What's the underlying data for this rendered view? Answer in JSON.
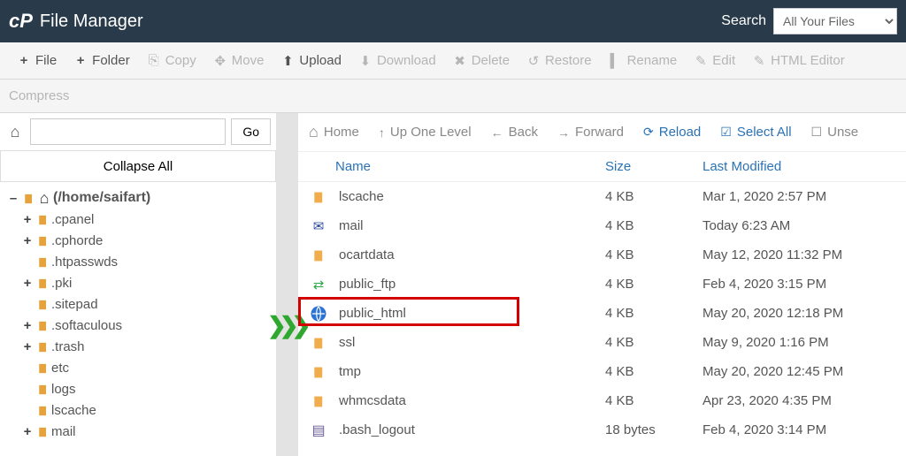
{
  "brand": {
    "logo": "cP",
    "title": "File Manager"
  },
  "search": {
    "label": "Search",
    "selected": "All Your Files"
  },
  "toolbar": {
    "file": "File",
    "folder": "Folder",
    "copy": "Copy",
    "move": "Move",
    "upload": "Upload",
    "download": "Download",
    "delete": "Delete",
    "restore": "Restore",
    "rename": "Rename",
    "edit": "Edit",
    "html_editor": "HTML Editor",
    "compress": "Compress"
  },
  "left": {
    "go": "Go",
    "collapse": "Collapse All",
    "root": "(/home/saifart)",
    "items": [
      {
        "label": ".cpanel",
        "expander": "plus",
        "icon": "folder"
      },
      {
        "label": ".cphorde",
        "expander": "plus",
        "icon": "folder"
      },
      {
        "label": ".htpasswds",
        "expander": "none",
        "icon": "folder"
      },
      {
        "label": ".pki",
        "expander": "plus",
        "icon": "folder"
      },
      {
        "label": ".sitepad",
        "expander": "none",
        "icon": "folder"
      },
      {
        "label": ".softaculous",
        "expander": "plus",
        "icon": "folder"
      },
      {
        "label": ".trash",
        "expander": "plus",
        "icon": "folder"
      },
      {
        "label": "etc",
        "expander": "none",
        "icon": "folder"
      },
      {
        "label": "logs",
        "expander": "none",
        "icon": "folder"
      },
      {
        "label": "lscache",
        "expander": "none",
        "icon": "folder"
      },
      {
        "label": "mail",
        "expander": "plus",
        "icon": "folder"
      }
    ]
  },
  "rnav": {
    "home": "Home",
    "up": "Up One Level",
    "back": "Back",
    "forward": "Forward",
    "reload": "Reload",
    "select_all": "Select All",
    "unselect": "Unse"
  },
  "columns": {
    "name": "Name",
    "size": "Size",
    "modified": "Last Modified"
  },
  "rows": [
    {
      "name": "lscache",
      "icon": "folder",
      "size": "4 KB",
      "modified": "Mar 1, 2020 2:57 PM"
    },
    {
      "name": "mail",
      "icon": "mail",
      "size": "4 KB",
      "modified": "Today 6:23 AM"
    },
    {
      "name": "ocartdata",
      "icon": "folder",
      "size": "4 KB",
      "modified": "May 12, 2020 11:32 PM"
    },
    {
      "name": "public_ftp",
      "icon": "ftp",
      "size": "4 KB",
      "modified": "Feb 4, 2020 3:15 PM"
    },
    {
      "name": "public_html",
      "icon": "globe",
      "size": "4 KB",
      "modified": "May 20, 2020 12:18 PM",
      "highlight": true
    },
    {
      "name": "ssl",
      "icon": "folder",
      "size": "4 KB",
      "modified": "May 9, 2020 1:16 PM"
    },
    {
      "name": "tmp",
      "icon": "folder",
      "size": "4 KB",
      "modified": "May 20, 2020 12:45 PM"
    },
    {
      "name": "whmcsdata",
      "icon": "folder",
      "size": "4 KB",
      "modified": "Apr 23, 2020 4:35 PM"
    },
    {
      "name": ".bash_logout",
      "icon": "doc",
      "size": "18 bytes",
      "modified": "Feb 4, 2020 3:14 PM"
    }
  ]
}
